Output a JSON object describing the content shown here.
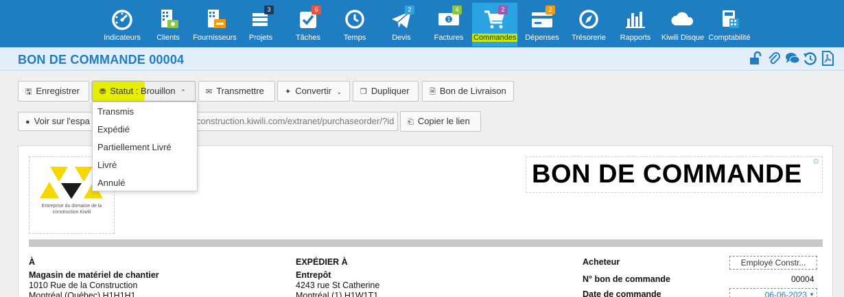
{
  "nav": {
    "items": [
      {
        "label": "Indicateurs",
        "icon": "dashboard-icon"
      },
      {
        "label": "Clients",
        "icon": "clients-icon"
      },
      {
        "label": "Fournisseurs",
        "icon": "suppliers-icon"
      },
      {
        "label": "Projets",
        "icon": "projects-icon",
        "badge": "3"
      },
      {
        "label": "Tâches",
        "icon": "tasks-icon",
        "badge": "6"
      },
      {
        "label": "Temps",
        "icon": "clock-icon"
      },
      {
        "label": "Devis",
        "icon": "send-icon",
        "badge": "2"
      },
      {
        "label": "Factures",
        "icon": "invoice-icon",
        "badge": "4"
      },
      {
        "label": "Commandes",
        "icon": "cart-icon",
        "badge": "2",
        "active": true
      },
      {
        "label": "Dépenses",
        "icon": "card-icon",
        "badge": "2"
      },
      {
        "label": "Trésorerie",
        "icon": "compass-icon"
      },
      {
        "label": "Rapports",
        "icon": "bar-chart-icon"
      },
      {
        "label": "Kiwili Disque",
        "icon": "cloud-icon"
      },
      {
        "label": "Comptabilité",
        "icon": "calculator-icon"
      }
    ],
    "badge_colors": {
      "Projets": "#1c3a5e",
      "Tâches": "#e8543f",
      "Devis": "#2ea3e0",
      "Factures": "#8cc63f",
      "Commandes": "#9b59b6",
      "Dépenses": "#f39c12"
    }
  },
  "header": {
    "title": "BON DE COMMANDE 00004",
    "icons": [
      "unlock-icon",
      "paperclip-icon",
      "comments-icon",
      "history-icon",
      "pdf-icon"
    ]
  },
  "toolbar": {
    "save_label": "Enregistrer",
    "status_prefix": "Statut : ",
    "status_value": "Brouillon",
    "send_label": "Transmettre",
    "convert_label": "Convertir",
    "duplicate_label": "Dupliquer",
    "delivery_label": "Bon de Livraison",
    "view_label": "Voir sur l'espa",
    "url_value": "construction.kiwili.com/extranet/purchaseorder/?id",
    "copy_label": "Copier le lien"
  },
  "status_menu": {
    "options": [
      "Transmis",
      "Expédié",
      "Partiellement Livré",
      "Livré",
      "Annulé"
    ]
  },
  "document": {
    "logo_caption": "Entreprise du domaine de la construction Kiwili",
    "title": "BON DE COMMANDE",
    "to": {
      "heading": "À",
      "name": "Magasin de matériel de chantier",
      "line1": "1010 Rue de la Construction",
      "line2": "Montréal (Québec) H1H1H1"
    },
    "ship": {
      "heading": "EXPÉDIER À",
      "name": "Entrepôt",
      "line1": "4243 rue St Catherine",
      "line2": "Montréal (1) H1W1T1"
    },
    "meta": {
      "buyer_label": "Acheteur",
      "buyer_value": "Employé Constr...",
      "po_label": "N° bon de commande",
      "po_value": "00004",
      "date_label": "Date de commande",
      "date_value": "06-06-2023"
    }
  },
  "colors": {
    "brand": "#1f7dc2",
    "highlight": "#e6ef00",
    "logo_yellow": "#f5d800"
  }
}
